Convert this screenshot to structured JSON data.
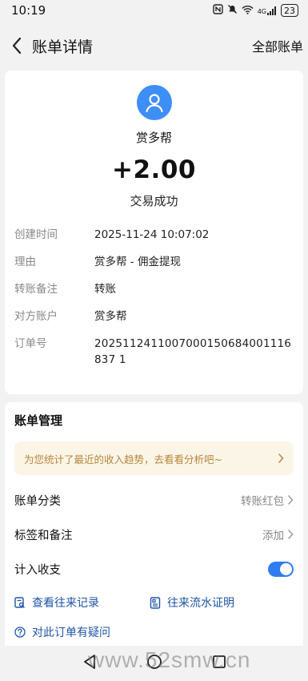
{
  "status_bar": {
    "time": "10:19",
    "network": "4G",
    "battery": "23"
  },
  "nav": {
    "title": "账单详情",
    "right_label": "全部账单"
  },
  "summary": {
    "payer": "赏多帮",
    "amount": "+2.00",
    "status": "交易成功",
    "details": [
      {
        "label": "创建时间",
        "value": "2025-11-24 10:07:02"
      },
      {
        "label": "理由",
        "value": "赏多帮 - 佣金提现"
      },
      {
        "label": "转账备注",
        "value": "转账"
      },
      {
        "label": "对方账户",
        "value": "赏多帮"
      },
      {
        "label": "订单号",
        "value": "2025112411007000150684001116837 1"
      }
    ]
  },
  "manage": {
    "title": "账单管理",
    "banner": "为您统计了最近的收入趋势，去看看分析吧~",
    "category_label": "账单分类",
    "category_value": "转账红包",
    "tags_label": "标签和备注",
    "tags_value": "添加",
    "include_label": "计入收支",
    "include_on": true,
    "link_history": "查看往来记录",
    "link_proof": "往来流水证明",
    "link_help": "对此订单有疑问"
  },
  "watermark": "www.52smw.cn",
  "colors": {
    "accent": "#2f7bf0",
    "avatar": "#3e8ef7",
    "link": "#1f55a8",
    "banner_text": "#b8863b"
  }
}
